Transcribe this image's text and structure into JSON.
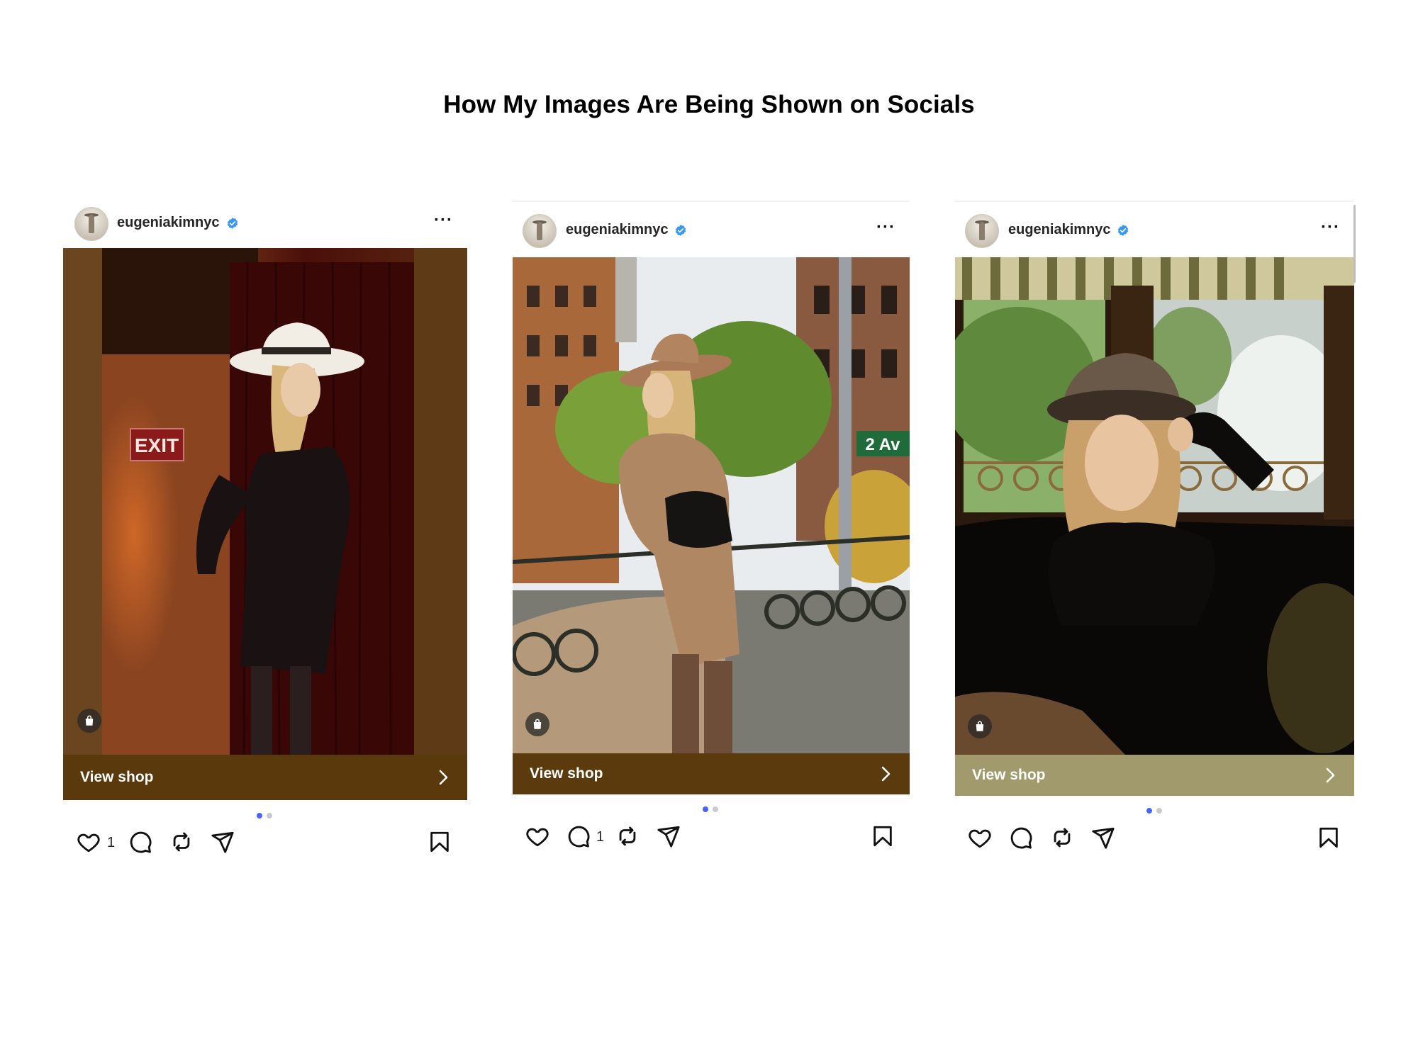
{
  "page": {
    "title": "How My Images Are Being Shown on Socials"
  },
  "colors": {
    "verified_blue": "#3897f0",
    "dot_active": "#4a63ff",
    "dot_inactive": "#c8cad0",
    "shopbar_post1": "#5a3a0c",
    "shopbar_post2": "#5b3b0d",
    "shopbar_post3": "#a09a6c"
  },
  "posts": [
    {
      "username": "eugeniakimnyc",
      "verified": true,
      "more_label": "···",
      "photo_description_icon": "shopping-bag-icon",
      "shop_label": "View shop",
      "likes": "1",
      "comments": "",
      "carousel_index": 1,
      "carousel_total": 2
    },
    {
      "username": "eugeniakimnyc",
      "verified": true,
      "more_label": "···",
      "photo_description_icon": "shopping-bag-icon",
      "shop_label": "View shop",
      "likes": "",
      "comments": "1",
      "carousel_index": 1,
      "carousel_total": 2
    },
    {
      "username": "eugeniakimnyc",
      "verified": true,
      "more_label": "···",
      "photo_description_icon": "shopping-bag-icon",
      "shop_label": "View shop",
      "likes": "",
      "comments": "",
      "carousel_index": 1,
      "carousel_total": 2
    }
  ]
}
